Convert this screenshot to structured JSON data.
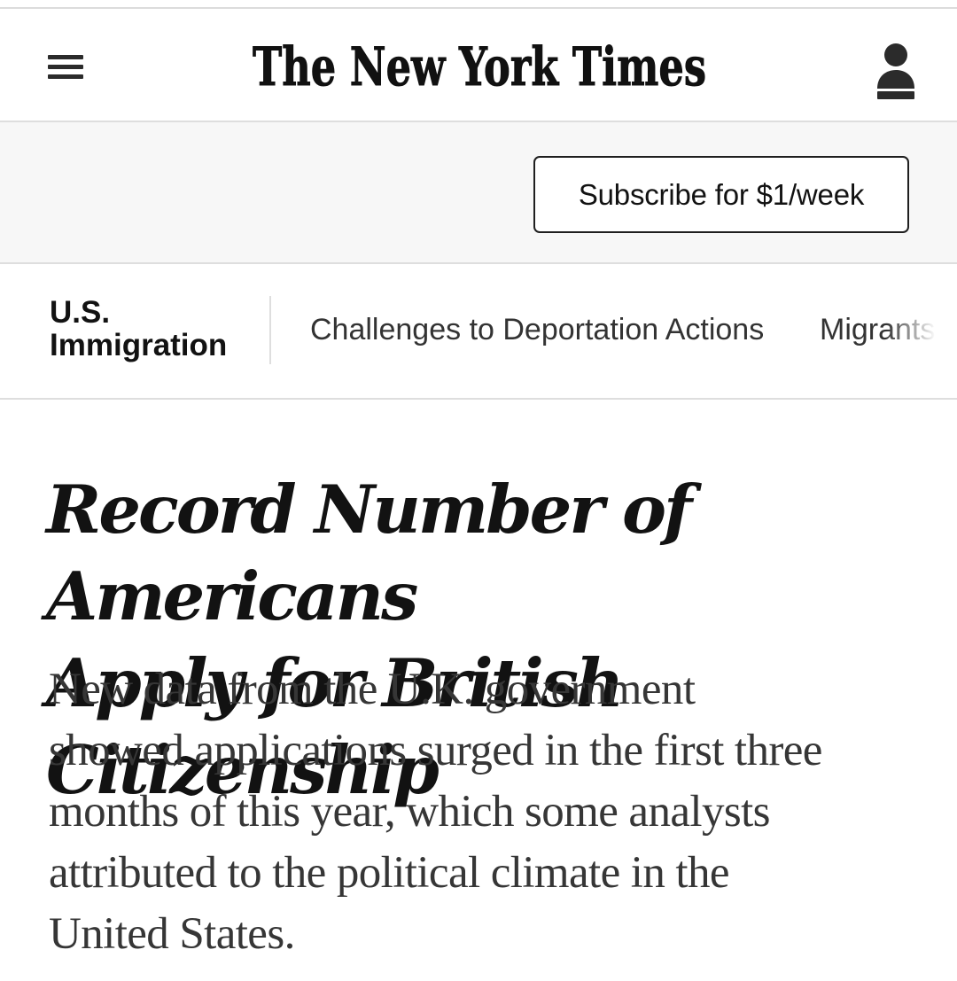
{
  "masthead": {
    "menu_icon": "hamburger-menu-icon",
    "logo_text": "The New York Times",
    "account_icon": "account-icon"
  },
  "subscribe": {
    "label": "Subscribe for $1/week"
  },
  "section_nav": {
    "section_label_line1": "U.S.",
    "section_label_line2": "Immigration",
    "links": [
      {
        "label": "Challenges to Deportation Actions"
      },
      {
        "label": "Migrants S"
      }
    ]
  },
  "article": {
    "headline_line1": "Record Number of Americans",
    "headline_line2": "Apply for British Citizenship",
    "summary_lines": [
      "New data from the U.K. government",
      "showed applications surged in the first three",
      "months of this year, which some analysts",
      "attributed to the political climate in the",
      "United States."
    ]
  },
  "colors": {
    "text": "#121212",
    "subscribe_band": "#f7f7f7",
    "divider": "#dedede",
    "summary_text": "#363636"
  }
}
